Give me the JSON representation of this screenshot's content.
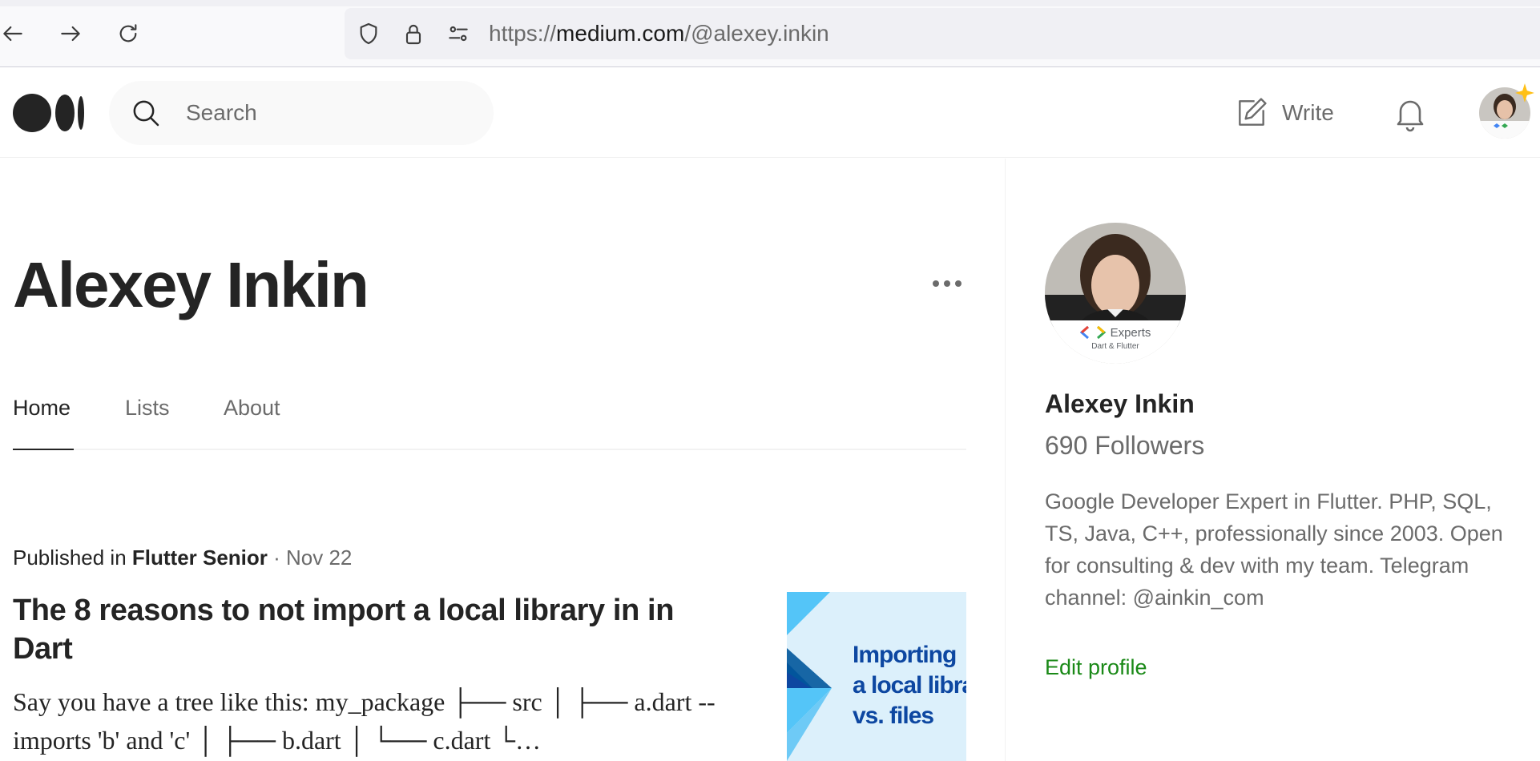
{
  "browser": {
    "url_scheme": "https://",
    "url_host": "medium.com",
    "url_path": "/@alexey.inkin",
    "icons": [
      "back-arrow-icon",
      "forward-arrow-icon",
      "reload-icon",
      "shield-icon",
      "lock-icon",
      "site-settings-icon"
    ]
  },
  "header": {
    "logo": "medium-logo",
    "search_placeholder": "Search",
    "write_label": "Write"
  },
  "profile": {
    "name": "Alexey Inkin",
    "tabs": [
      {
        "label": "Home",
        "active": true
      },
      {
        "label": "Lists",
        "active": false
      },
      {
        "label": "About",
        "active": false
      }
    ]
  },
  "article": {
    "published_prefix": "Published in ",
    "publication": "Flutter Senior",
    "date": " · Nov 22",
    "title": "The 8 reasons to not import a local library in in Dart",
    "excerpt": "Say you have a tree like this: my_package ├── src │ ├── a.dart -- imports 'b' and 'c' │ ├── b.dart │ └── c.dart └…",
    "thumbnail_text_1": "Importing",
    "thumbnail_text_2": "a local libra",
    "thumbnail_text_3": "vs. files"
  },
  "sidebar": {
    "name": "Alexey Inkin",
    "followers": "690 Followers",
    "bio": "Google Developer Expert in Flutter. PHP, SQL, TS, Java, C++, professionally since 2003. Open for consulting & dev with my team. Telegram channel: @ainkin_com",
    "edit_profile": "Edit profile",
    "badge_title": "Experts",
    "badge_subtitle": "Dart & Flutter"
  },
  "colors": {
    "accent_green": "#1a8917",
    "text_primary": "#242424",
    "text_secondary": "#6b6b6b",
    "thumb_blue": "#0d47a1"
  }
}
